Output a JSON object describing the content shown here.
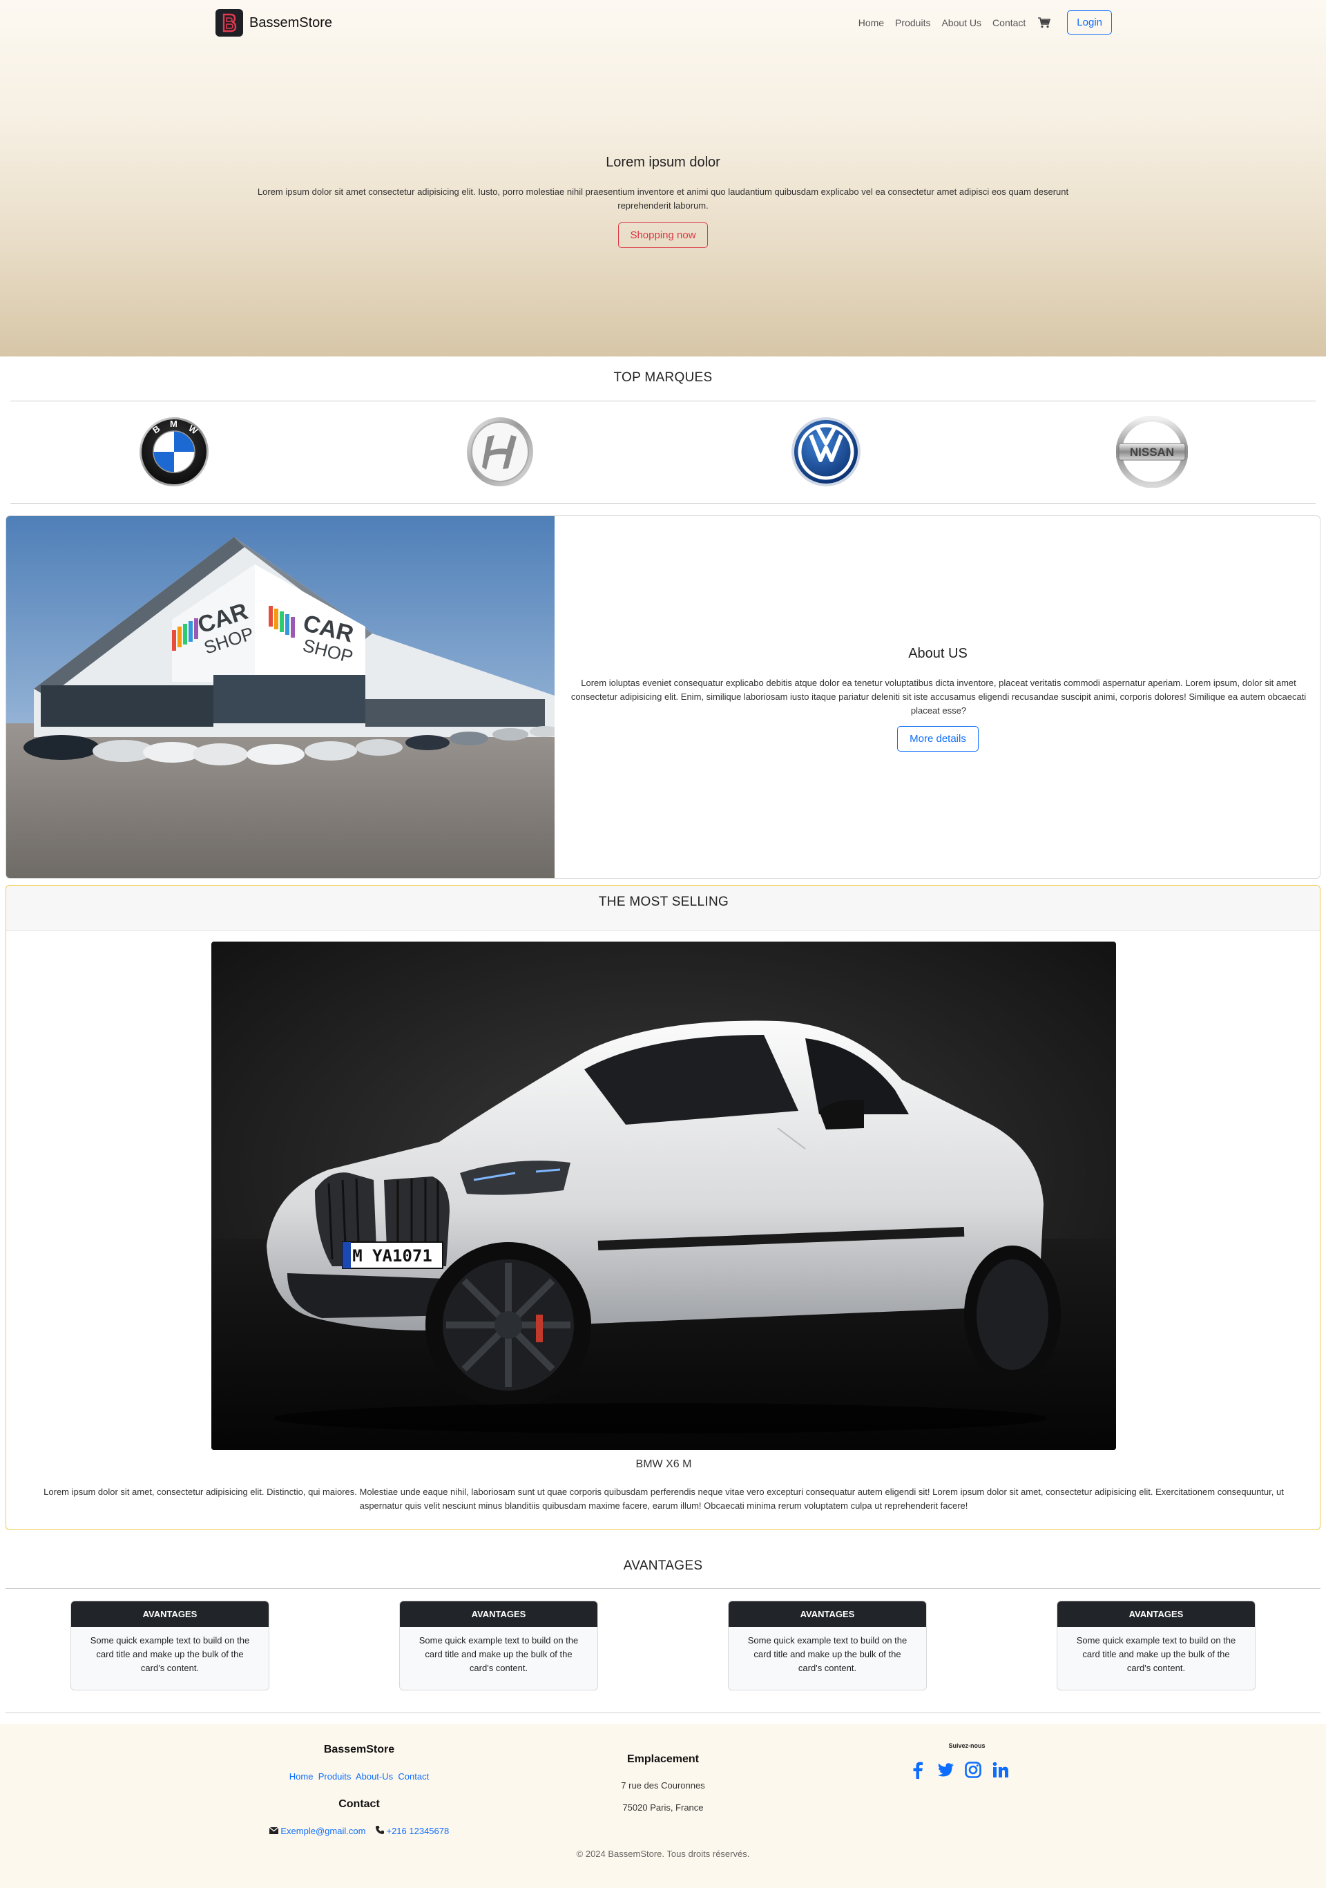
{
  "nav": {
    "brand": "BassemStore",
    "links": [
      "Home",
      "Produits",
      "About Us",
      "Contact"
    ],
    "login": "Login"
  },
  "hero": {
    "title": "Lorem ipsum dolor",
    "text": "Lorem ipsum dolor sit amet consectetur adipisicing elit. Iusto, porro molestiae nihil praesentium inventore et animi quo laudantium quibusdam explicabo vel ea consectetur amet adipisci eos quam deserunt reprehenderit laborum.",
    "button": "Shopping now"
  },
  "marques": {
    "title": "TOP MARQUES",
    "brands": [
      "BMW",
      "Hyundai",
      "Volkswagen",
      "NISSAN"
    ]
  },
  "about": {
    "title": "About US",
    "text": "Lorem ioluptas eveniet consequatur explicabo debitis atque dolor ea tenetur voluptatibus dicta inventore, placeat veritatis commodi aspernatur aperiam. Lorem ipsum, dolor sit amet consectetur adipisicing elit. Enim, similique laboriosam iusto itaque pariatur deleniti sit iste accusamus eligendi recusandae suscipit animi, corporis dolores! Similique ea autem obcaecati placeat esse?",
    "button": "More details",
    "sign_text_1": "CAR",
    "sign_text_2": "SHOP"
  },
  "selling": {
    "title": "THE MOST SELLING",
    "car_name": "BMW X6 M",
    "plate": "M YA1071",
    "text": "Lorem ipsum dolor sit amet, consectetur adipisicing elit. Distinctio, qui maiores. Molestiae unde eaque nihil, laboriosam sunt ut quae corporis quibusdam perferendis neque vitae vero excepturi consequatur autem eligendi sit! Lorem ipsum dolor sit amet, consectetur adipisicing elit. Exercitationem consequuntur, ut aspernatur quis velit nesciunt minus blanditiis quibusdam maxime facere, earum illum! Obcaecati minima rerum voluptatem culpa ut reprehenderit facere!"
  },
  "avantages": {
    "title": "AVANTAGES",
    "cards": [
      {
        "head": "AVANTAGES",
        "body": "Some quick example text to build on the card title and make up the bulk of the card's content."
      },
      {
        "head": "AVANTAGES",
        "body": "Some quick example text to build on the card title and make up the bulk of the card's content."
      },
      {
        "head": "AVANTAGES",
        "body": "Some quick example text to build on the card title and make up the bulk of the card's content."
      },
      {
        "head": "AVANTAGES",
        "body": "Some quick example text to build on the card title and make up the bulk of the card's content."
      }
    ]
  },
  "footer": {
    "brand": "BassemStore",
    "links": [
      "Home",
      "Produits",
      "About-Us",
      "Contact"
    ],
    "contact_title": "Contact",
    "email": "Exemple@gmail.com",
    "phone": "+216 12345678",
    "location_title": "Emplacement",
    "address_1": "7 rue des Couronnes",
    "address_2": "75020 Paris, France",
    "follow": "Suivez-nous",
    "social": [
      "facebook-icon",
      "twitter-icon",
      "instagram-icon",
      "linkedin-icon"
    ],
    "copyright": "© 2024 BassemStore. Tous droits réservés."
  },
  "colors": {
    "primary": "#0d6efd",
    "danger": "#dc3545",
    "warning_border": "#f2c94c",
    "dark": "#212529",
    "footer_bg": "#fdf8ee"
  }
}
